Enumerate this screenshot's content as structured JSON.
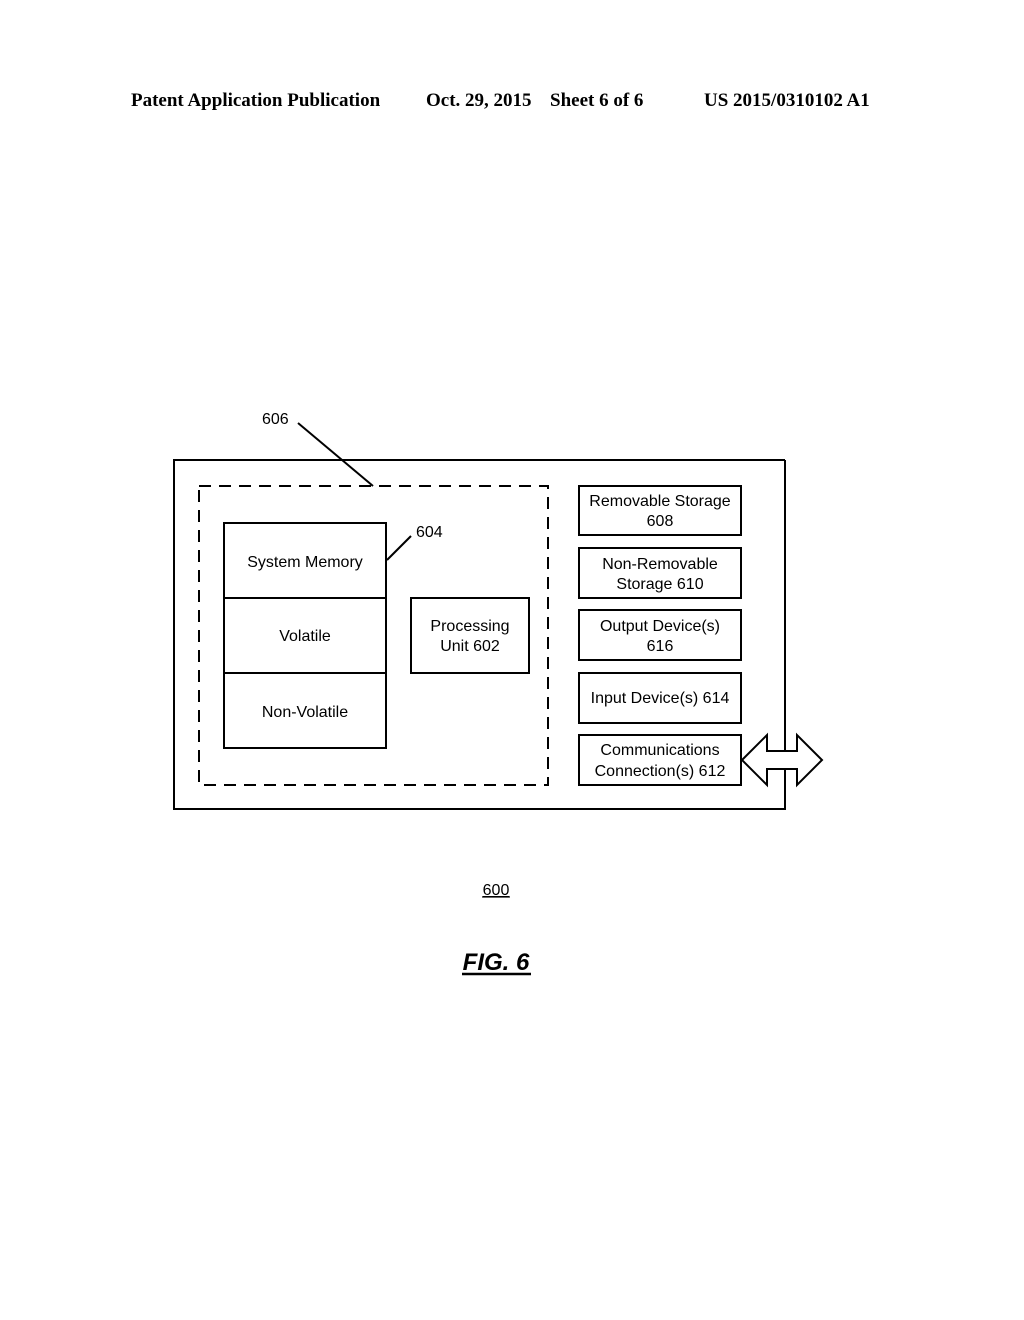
{
  "header": {
    "publication": "Patent Application Publication",
    "date": "Oct. 29, 2015",
    "sheet": "Sheet 6 of 6",
    "number": "US 2015/0310102 A1"
  },
  "diagram": {
    "ref_606": "606",
    "ref_604": "604",
    "memory": {
      "title": "System Memory",
      "volatile": "Volatile",
      "non_volatile": "Non-Volatile"
    },
    "processing_unit": [
      "Processing",
      "Unit 602"
    ],
    "components": [
      {
        "lines": [
          "Removable Storage",
          "608"
        ]
      },
      {
        "lines": [
          "Non-Removable",
          "Storage 610"
        ]
      },
      {
        "lines": [
          "Output Device(s)",
          "616"
        ]
      },
      {
        "lines": [
          "Input Device(s) 614"
        ]
      },
      {
        "lines": [
          "Communications",
          "Connection(s) 612"
        ]
      }
    ],
    "device_ref": "600",
    "figure_label": "FIG. 6"
  }
}
